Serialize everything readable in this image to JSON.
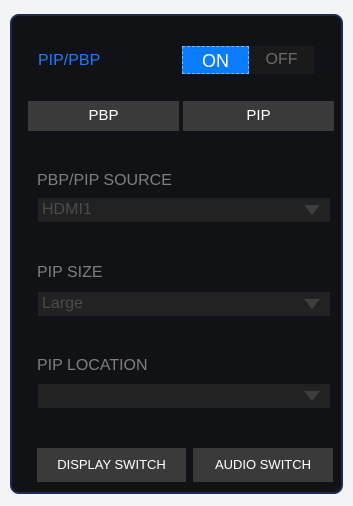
{
  "pip": {
    "title": "PIP/PBP",
    "toggle_on": "ON",
    "toggle_off": "OFF"
  },
  "mode_buttons": {
    "pbp": "PBP",
    "pip": "PIP"
  },
  "source": {
    "label": "PBP/PIP SOURCE",
    "value": "HDMI1"
  },
  "size": {
    "label": "PIP SIZE",
    "value": "Large"
  },
  "location": {
    "label": "PIP LOCATION",
    "value": ""
  },
  "bottom_buttons": {
    "display_switch": "DISPLAY SWITCH",
    "audio_switch": "AUDIO SWITCH"
  },
  "colors": {
    "accent": "#1e7bff",
    "panel_bg": "#111215",
    "button_bg": "#3a3a3a"
  }
}
